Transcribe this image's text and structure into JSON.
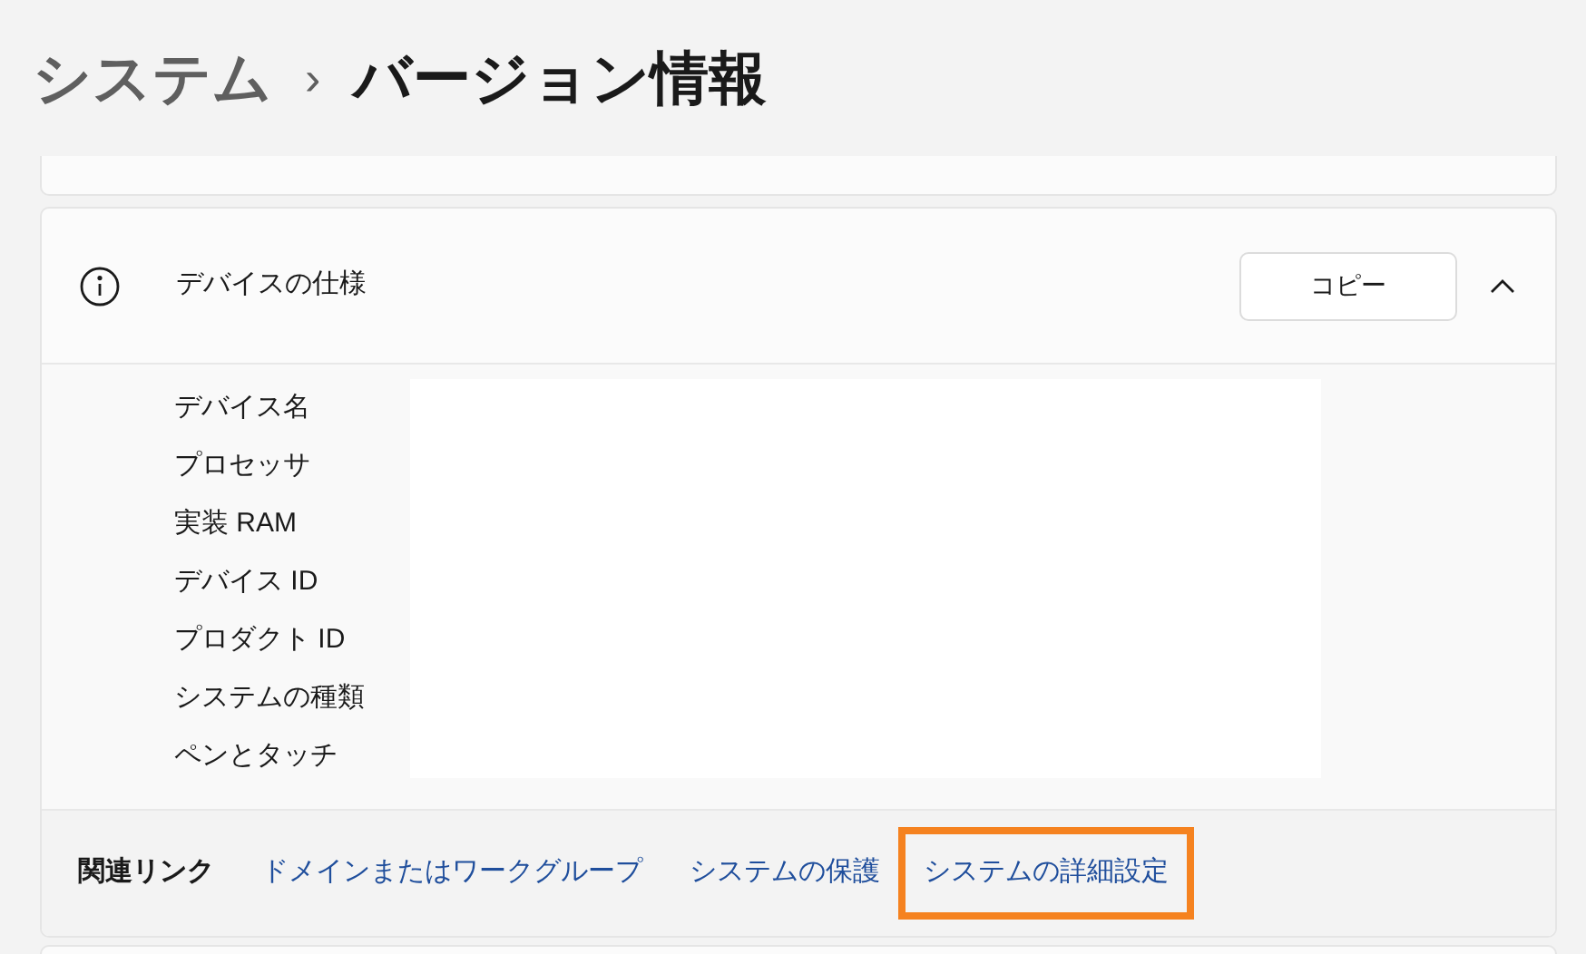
{
  "breadcrumb": {
    "parent": "システム",
    "separator": "›",
    "current": "バージョン情報"
  },
  "spec_card": {
    "title": "デバイスの仕様",
    "copy_button": "コピー",
    "expanded": true,
    "specs": [
      {
        "label": "デバイス名"
      },
      {
        "label": "プロセッサ"
      },
      {
        "label": "実装 RAM"
      },
      {
        "label": "デバイス ID"
      },
      {
        "label": "プロダクト ID"
      },
      {
        "label": "システムの種類"
      },
      {
        "label": "ペンとタッチ"
      }
    ],
    "related_links": {
      "heading": "関連リンク",
      "links": [
        {
          "label": "ドメインまたはワークグループ",
          "highlighted": false
        },
        {
          "label": "システムの保護",
          "highlighted": false
        },
        {
          "label": "システムの詳細設定",
          "highlighted": true
        }
      ]
    }
  }
}
